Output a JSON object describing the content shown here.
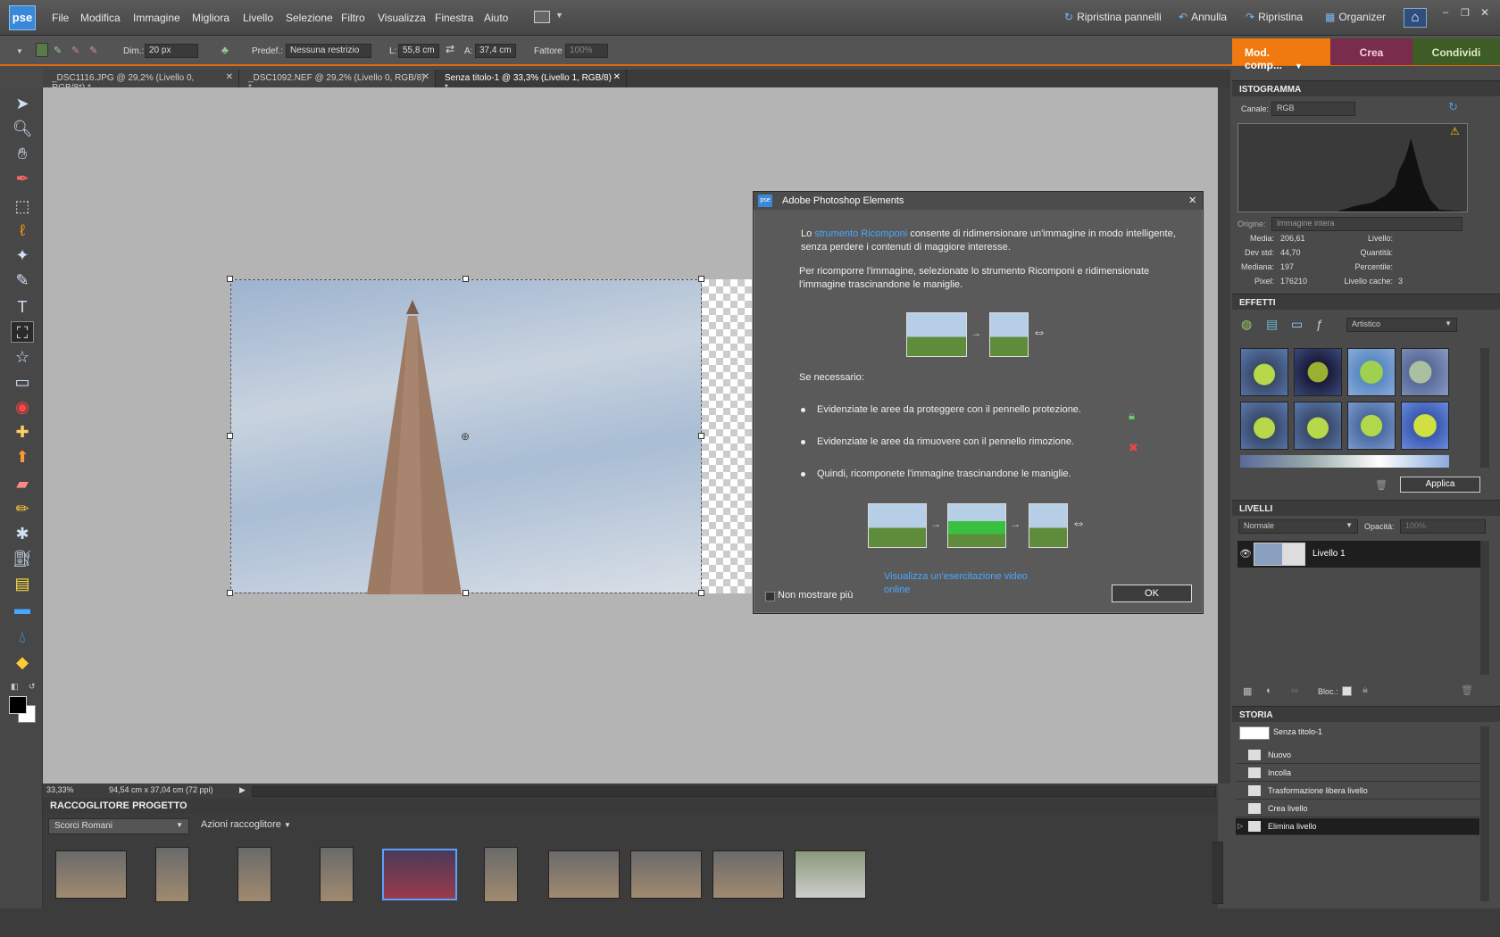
{
  "app": {
    "logo": "pse"
  },
  "menu": [
    "File",
    "Modifica",
    "Immagine",
    "Migliora",
    "Livello",
    "Selezione",
    "Filtro",
    "Visualizza",
    "Finestra",
    "Aiuto"
  ],
  "menu_right": {
    "reset_panels": "Ripristina pannelli",
    "undo": "Annulla",
    "redo": "Ripristina",
    "organizer": "Organizer"
  },
  "options": {
    "dim_label": "Dim.:",
    "dim_value": "20 px",
    "preset_label": "Predef.:",
    "preset_value": "Nessuna restrizio",
    "width_label": "L:",
    "width_value": "55,8 cm",
    "height_label": "A:",
    "height_value": "37,4 cm",
    "factor_label": "Fattore",
    "factor_value": "100%"
  },
  "modes": {
    "edit": "Mod. comp...",
    "create": "Crea",
    "share": "Condividi"
  },
  "doc_tabs": [
    "_DSC1116.JPG @ 29,2% (Livello 0, RGB/8*) *",
    "_DSC1092.NEF @ 29,2% (Livello 0, RGB/8) *",
    "Senza titolo-1 @ 33,3% (Livello 1, RGB/8) *"
  ],
  "status": {
    "zoom": "33,33%",
    "size": "94,54 cm x 37,04 cm (72 ppi)"
  },
  "bin": {
    "title": "RACCOGLITORE PROGETTO",
    "album": "Scorci Romani",
    "actions": "Azioni raccoglitore"
  },
  "histogram": {
    "title": "ISTOGRAMMA",
    "channel_label": "Canale:",
    "channel": "RGB",
    "source_label": "Origine:",
    "source": "Immagine intera",
    "stats": {
      "media_label": "Media:",
      "media": "206,61",
      "devstd_label": "Dev std:",
      "devstd": "44,70",
      "mediana_label": "Mediana:",
      "mediana": "197",
      "pixel_label": "Pixel:",
      "pixel": "176210",
      "livello_label": "Livello:",
      "quantita_label": "Quantità:",
      "percentile_label": "Percentile:",
      "cache_label": "Livello cache:",
      "cache": "3"
    }
  },
  "effects": {
    "title": "EFFETTI",
    "category": "Artistico",
    "apply": "Applica"
  },
  "layers": {
    "title": "LIVELLI",
    "blend": "Normale",
    "opacity_label": "Opacità:",
    "opacity": "100%",
    "layer_name": "Livello 1",
    "lock_label": "Bloc.:"
  },
  "history": {
    "title": "STORIA",
    "doc": "Senza titolo-1",
    "items": [
      "Nuovo",
      "Incolla",
      "Trasformazione libera livello",
      "Crea livello",
      "Elimina livello"
    ]
  },
  "dialog": {
    "title": "Adobe Photoshop Elements",
    "p1_pre": "Lo",
    "p1_link": "strumento Ricomponi",
    "p1_post": "consente di ridimensionare un'immagine in modo intelligente, senza perdere i contenuti di maggiore interesse.",
    "p2": "Per ricomporre l'immagine, selezionate lo strumento Ricomponi e ridimensionate l'immagine trascinandone le maniglie.",
    "p3": "Se necessario:",
    "bullets": [
      "Evidenziate le aree da proteggere con il pennello protezione.",
      "Evidenziate le aree da rimuovere con il pennello rimozione.",
      "Quindi, ricomponete l'immagine trascinandone le maniglie."
    ],
    "video_link": "Visualizza un'esercitazione video online",
    "no_show": "Non mostrare più",
    "ok": "OK"
  }
}
